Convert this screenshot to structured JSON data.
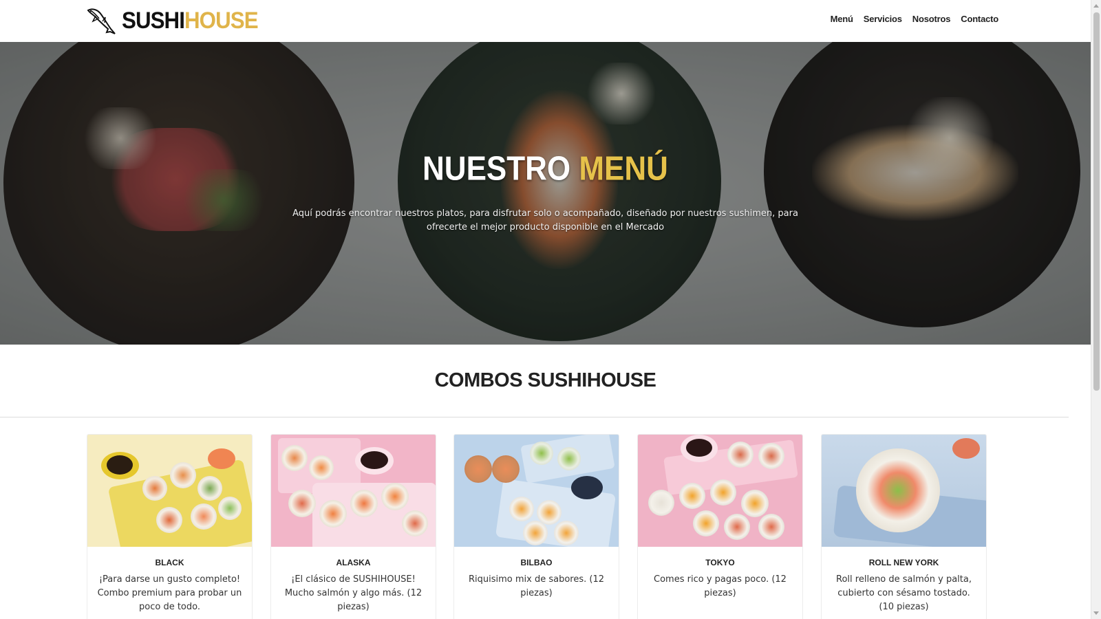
{
  "brand": {
    "part1": "SUSHI",
    "part2": "HOUSE"
  },
  "nav": {
    "items": [
      "Menú",
      "Servicios",
      "Nosotros",
      "Contacto"
    ]
  },
  "hero": {
    "title_part1": "NUESTRO",
    "title_part2": "MENÚ",
    "subtitle": "Aquí podrás encontrar nuestros platos, para disfrutar solo o acompañado, diseñado por nuestros sushimen, para ofrecerte el mejor producto disponible en el Mercado"
  },
  "section": {
    "title": "COMBOS SUSHIHOUSE"
  },
  "cards": [
    {
      "name": "BLACK",
      "desc": "¡Para darse un gusto completo! Combo premium para probar un poco de todo."
    },
    {
      "name": "ALASKA",
      "desc": "¡El clásico de SUSHIHOUSE! Mucho salmón y algo más. (12 piezas)"
    },
    {
      "name": "BILBAO",
      "desc": "Riquisimo mix de sabores. (12 piezas)"
    },
    {
      "name": "TOKYO",
      "desc": "Comes rico y pagas poco. (12 piezas)"
    },
    {
      "name": "ROLL NEW YORK",
      "desc": "Roll relleno de salmón y palta, cubierto con sésamo tostado. (10 piezas)"
    }
  ],
  "colors": {
    "accent": "#e0b44a",
    "text": "#222222"
  }
}
